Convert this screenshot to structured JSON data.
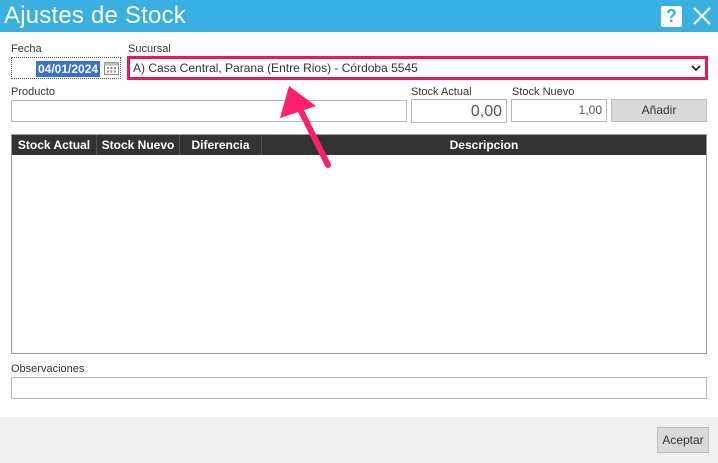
{
  "window": {
    "title": "Ajustes de Stock",
    "help_label": "?"
  },
  "form": {
    "fecha_label": "Fecha",
    "fecha_value": "04/01/2024",
    "sucursal_label": "Sucursal",
    "sucursal_value": "A) Casa Central, Parana (Entre Rios) - Córdoba 5545",
    "producto_label": "Producto",
    "producto_value": "",
    "stock_actual_label": "Stock Actual",
    "stock_actual_value": "0,00",
    "stock_nuevo_label": "Stock Nuevo",
    "stock_nuevo_value": "1,00",
    "add_button": "Añadir"
  },
  "grid": {
    "columns": [
      "Stock Actual",
      "Stock Nuevo",
      "Diferencia",
      "Descripcion"
    ]
  },
  "observaciones": {
    "label": "Observaciones",
    "value": ""
  },
  "footer": {
    "accept_button": "Aceptar"
  },
  "colors": {
    "titlebar": "#3ab0e2",
    "highlight": "#e8195a",
    "grid_header": "#333333"
  }
}
